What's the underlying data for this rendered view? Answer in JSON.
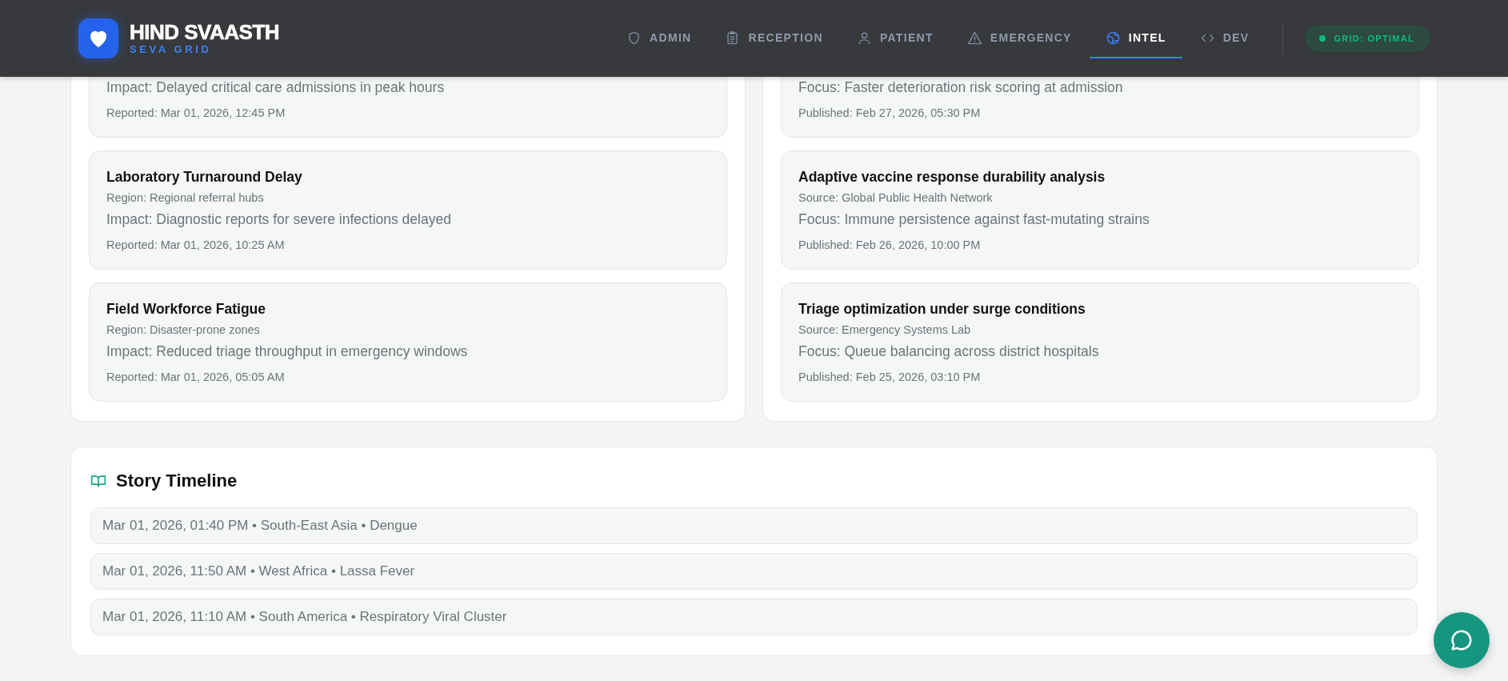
{
  "header": {
    "brand": {
      "title": "HIND SVAASTH",
      "subtitle": "SEVA GRID"
    },
    "nav": [
      {
        "label": "ADMIN",
        "selected": false
      },
      {
        "label": "RECEPTION",
        "selected": false
      },
      {
        "label": "PATIENT",
        "selected": false
      },
      {
        "label": "EMERGENCY",
        "selected": false
      },
      {
        "label": "INTEL",
        "selected": true
      },
      {
        "label": "DEV",
        "selected": false
      }
    ],
    "status_badge": {
      "label": "GRID: OPTIMAL"
    }
  },
  "alerts": [
    {
      "impact": "Impact: Delayed critical care admissions in peak hours",
      "reported": "Reported: Mar 01, 2026, 12:45 PM"
    },
    {
      "title": "Laboratory Turnaround Delay",
      "region": "Region: Regional referral hubs",
      "impact": "Impact: Diagnostic reports for severe infections delayed",
      "reported": "Reported: Mar 01, 2026, 10:25 AM"
    },
    {
      "title": "Field Workforce Fatigue",
      "region": "Region: Disaster-prone zones",
      "impact": "Impact: Reduced triage throughput in emergency windows",
      "reported": "Reported: Mar 01, 2026, 05:05 AM"
    }
  ],
  "research": [
    {
      "focus": "Focus: Faster deterioration risk scoring at admission",
      "published": "Published: Feb 27, 2026, 05:30 PM"
    },
    {
      "title": "Adaptive vaccine response durability analysis",
      "source": "Source: Global Public Health Network",
      "focus": "Focus: Immune persistence against fast-mutating strains",
      "published": "Published: Feb 26, 2026, 10:00 PM"
    },
    {
      "title": "Triage optimization under surge conditions",
      "source": "Source: Emergency Systems Lab",
      "focus": "Focus: Queue balancing across district hospitals",
      "published": "Published: Feb 25, 2026, 03:10 PM"
    }
  ],
  "timeline": {
    "title": "Story Timeline",
    "entries": [
      "Mar 01, 2026, 01:40 PM • South-East Asia • Dengue",
      "Mar 01, 2026, 11:50 AM • West Africa • Lassa Fever",
      "Mar 01, 2026, 11:10 AM • South America • Respiratory Viral Cluster"
    ]
  }
}
